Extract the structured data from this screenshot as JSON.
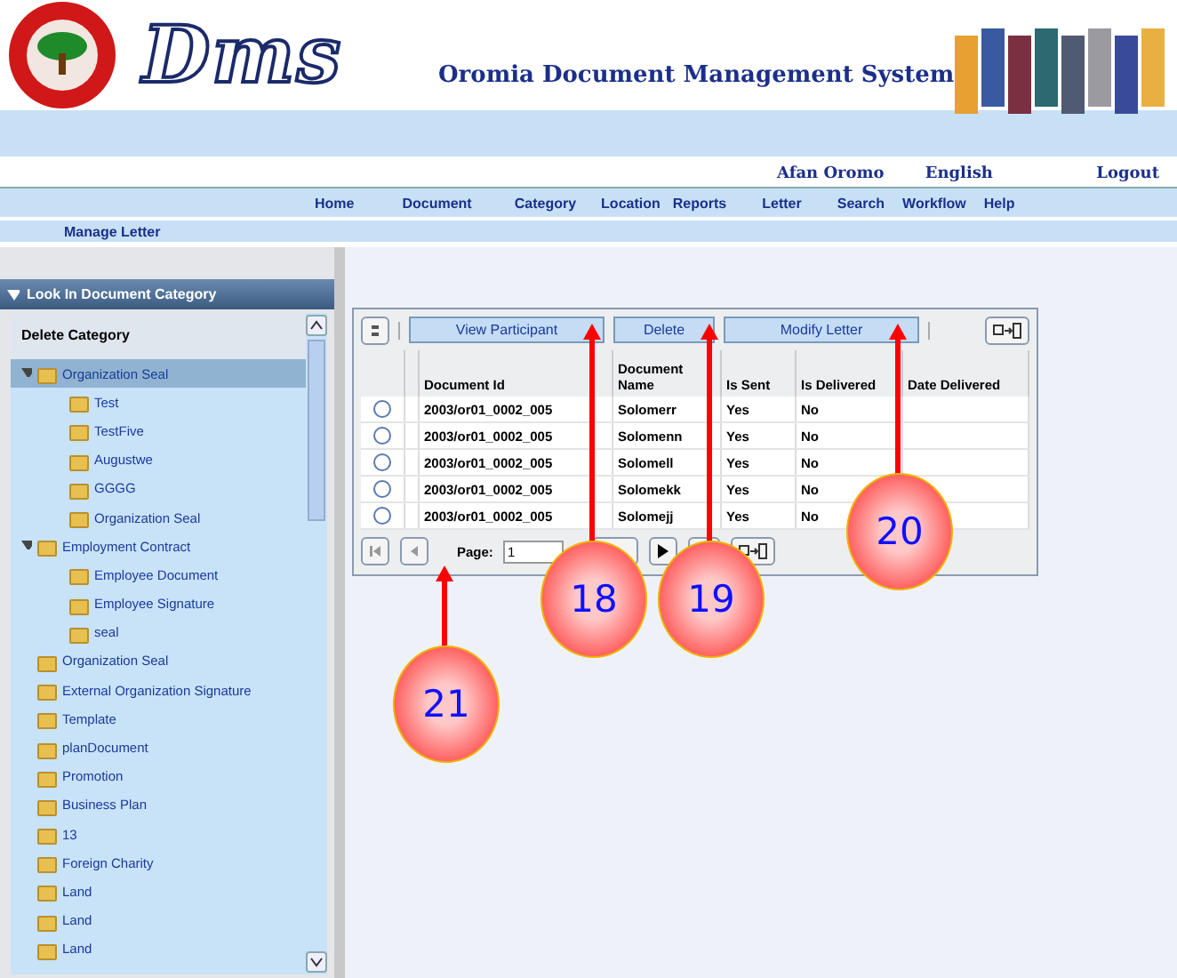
{
  "header": {
    "logo_text": "Dms",
    "title": "Oromia Document Management System"
  },
  "language_links": [
    "Afan Oromo",
    "English"
  ],
  "logout": "Logout",
  "nav": [
    {
      "label": "Home"
    },
    {
      "label": "Document"
    },
    {
      "label": "Category"
    },
    {
      "label": "Location"
    },
    {
      "label": "Reports"
    },
    {
      "label": "Letter"
    },
    {
      "label": "Search"
    },
    {
      "label": "Workflow"
    },
    {
      "label": "Help"
    }
  ],
  "breadcrumb": "Manage Letter",
  "sidebar": {
    "title": "Look In Document Category",
    "action": "Delete Category",
    "items": [
      {
        "label": "Organization Seal",
        "selected": true,
        "expanded": true,
        "children": [
          {
            "label": "Test",
            "selected": false
          },
          {
            "label": "TestFive",
            "selected": false
          },
          {
            "label": "Augustwe",
            "selected": false
          },
          {
            "label": "GGGG",
            "selected": false
          },
          {
            "label": "Organization Seal",
            "selected": false
          }
        ]
      },
      {
        "label": "Employment Contract",
        "selected": false,
        "expanded": true,
        "children": [
          {
            "label": "Employee Document",
            "selected": false
          },
          {
            "label": "Employee Signature",
            "selected": false
          },
          {
            "label": "seal",
            "selected": false
          }
        ]
      },
      {
        "label": "Organization Seal",
        "selected": false
      },
      {
        "label": "External Organization Signature",
        "selected": false
      },
      {
        "label": "Template",
        "selected": false
      },
      {
        "label": "planDocument",
        "selected": false
      },
      {
        "label": "Promotion",
        "selected": false
      },
      {
        "label": "Business Plan",
        "selected": false
      },
      {
        "label": "13",
        "selected": false
      },
      {
        "label": "Foreign Charity",
        "selected": false
      },
      {
        "label": "Land",
        "selected": false
      },
      {
        "label": "Land",
        "selected": false
      },
      {
        "label": "Land",
        "selected": false
      }
    ]
  },
  "grid": {
    "buttons": [
      "View Participant",
      "Delete",
      "Modify Letter"
    ],
    "columns": [
      "Document Id",
      "Document Name",
      "Is Sent",
      "Is Delivered",
      "Date Delivered"
    ],
    "rows": [
      {
        "selected": false,
        "cells": [
          "2003/or01_0002_005",
          "Solomerr",
          "Yes",
          "No"
        ]
      },
      {
        "selected": false,
        "cells": [
          "2003/or01_0002_005",
          "Solomenn",
          "Yes",
          "No"
        ]
      },
      {
        "selected": false,
        "cells": [
          "2003/or01_0002_005",
          "Solomell",
          "Yes",
          "No"
        ]
      },
      {
        "selected": false,
        "cells": [
          "2003/or01_0002_005",
          "Solomekk",
          "Yes",
          "No"
        ]
      },
      {
        "selected": false,
        "cells": [
          "2003/or01_0002_005",
          "Solomejj",
          "Yes",
          "No"
        ]
      }
    ],
    "pager": {
      "label": "Page:",
      "value": "1"
    }
  },
  "callouts": [
    {
      "label": "18"
    },
    {
      "label": "19"
    },
    {
      "label": "20"
    },
    {
      "label": "21"
    }
  ]
}
